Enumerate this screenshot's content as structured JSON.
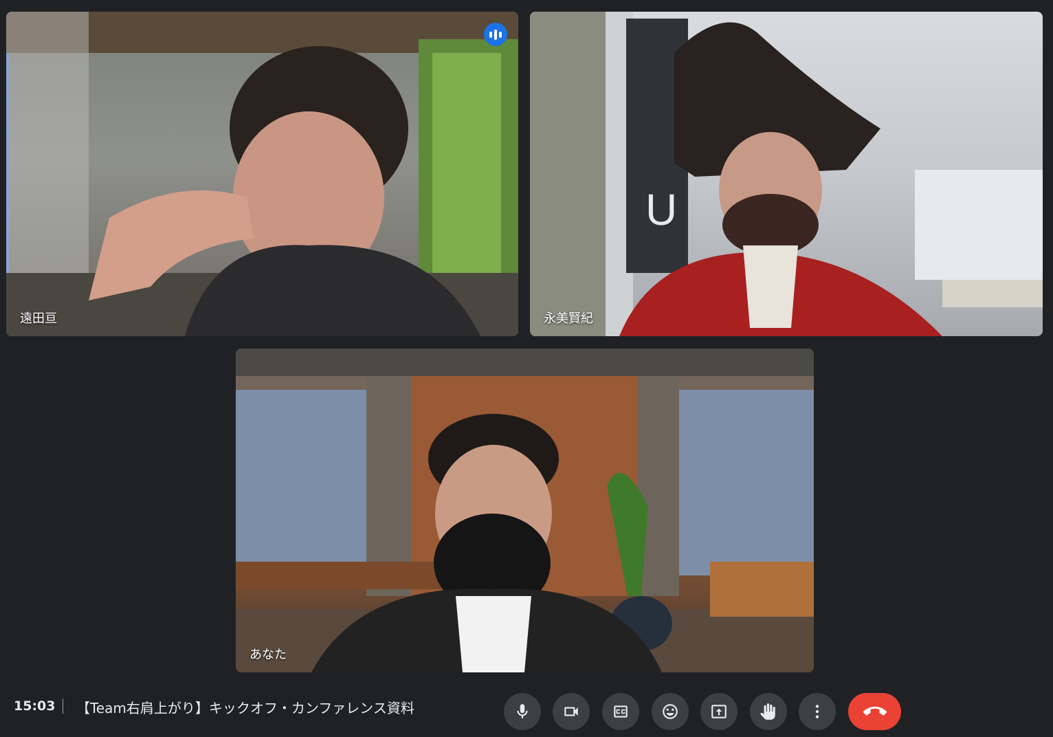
{
  "participants": [
    {
      "name": "遠田亘",
      "speaking": true
    },
    {
      "name": "永美賢紀",
      "speaking": false
    },
    {
      "name": "あなた",
      "speaking": false
    }
  ],
  "meeting": {
    "time": "15:03",
    "title": "【Team右肩上がり】キックオフ・カンファレンス資料"
  },
  "controls": [
    {
      "icon": "microphone-icon"
    },
    {
      "icon": "camera-icon"
    },
    {
      "icon": "captions-icon"
    },
    {
      "icon": "emoji-icon"
    },
    {
      "icon": "present-screen-icon"
    },
    {
      "icon": "raise-hand-icon"
    },
    {
      "icon": "more-options-icon"
    },
    {
      "icon": "end-call-icon"
    }
  ],
  "colors": {
    "background": "#202124",
    "active_speaker_border": "#5b8def",
    "end_call": "#ea4335",
    "control_bg": "#3c4043"
  }
}
